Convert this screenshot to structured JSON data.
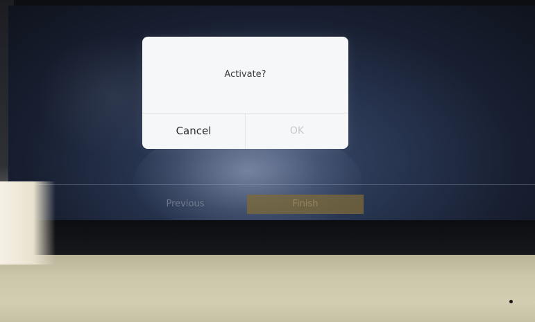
{
  "dialog": {
    "message": "Activate?",
    "cancel_label": "Cancel",
    "ok_label": "OK"
  },
  "wizard": {
    "previous_label": "Previous",
    "finish_label": "Finish"
  },
  "colors": {
    "dialog_background": "#f6f7f9",
    "ok_disabled_text": "#c9cacd",
    "finish_button": "#7d6937",
    "housing": "#d3cdb2"
  }
}
